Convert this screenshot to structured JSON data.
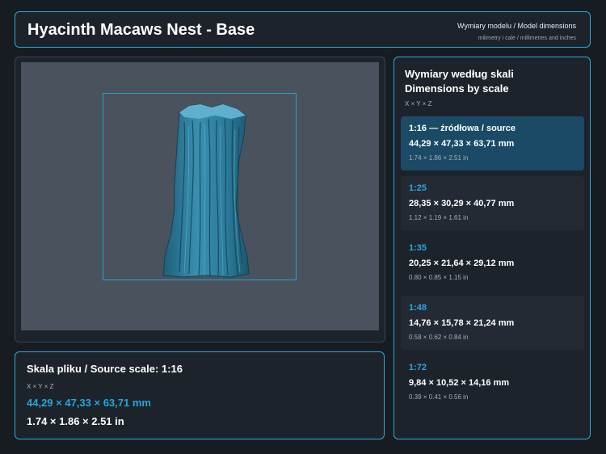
{
  "header": {
    "title": "Hyacinth Macaws Nest - Base",
    "dims_label": "Wymiary modelu / Model dimensions",
    "units_label": "milimetry i cale / millimetres and inches"
  },
  "source": {
    "title": "Skala pliku / Source scale: 1:16",
    "axes": "X × Y × Z",
    "mm": "44,29 × 47,33 × 63,71 mm",
    "inches": "1.74 × 1.86 × 2.51 in"
  },
  "scales": {
    "title_pl": "Wymiary według skali",
    "title_en": "Dimensions by scale",
    "axes": "X × Y × Z",
    "items": [
      {
        "ratio": "1:16  —  źródłowa / source",
        "mm": "44,29 × 47,33 × 63,71 mm",
        "inches": "1.74 × 1.86 × 2.51 in"
      },
      {
        "ratio": "1:25",
        "mm": "28,35 × 30,29 × 40,77 mm",
        "inches": "1.12 × 1.19 × 1.61 in"
      },
      {
        "ratio": "1:35",
        "mm": "20,25 × 21,64 × 29,12 mm",
        "inches": "0.80 × 0.85 × 1.15 in"
      },
      {
        "ratio": "1:48",
        "mm": "14,76 × 15,78 × 21,24 mm",
        "inches": "0.58 × 0.62 × 0.84 in"
      },
      {
        "ratio": "1:72",
        "mm": "9,84 × 10,52 × 14,16 mm",
        "inches": "0.39 × 0.41 × 0.56 in"
      }
    ]
  },
  "colors": {
    "accent": "#2aa8d8",
    "model": "#2f7f9e",
    "viewport_bg": "#4a535d",
    "active_card": "#1a4a66"
  }
}
